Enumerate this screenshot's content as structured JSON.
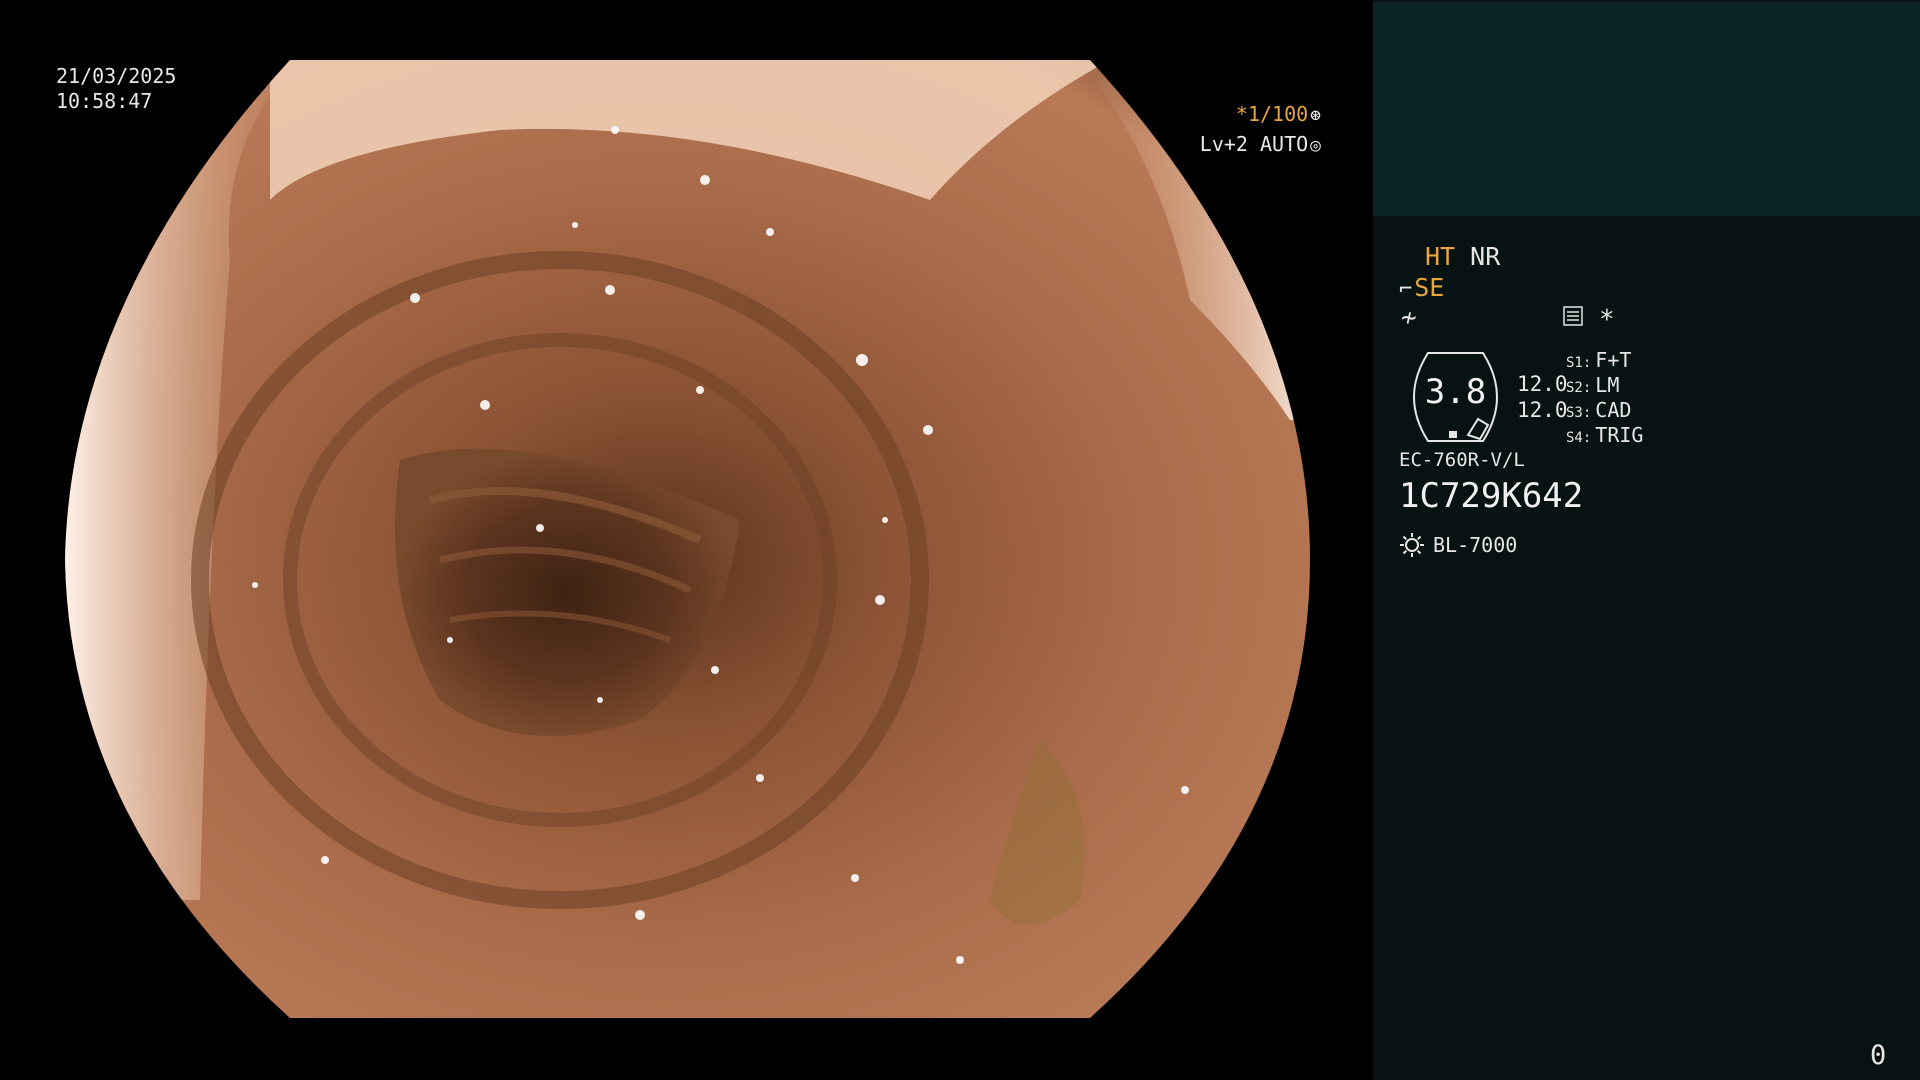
{
  "overlay": {
    "date": "21/03/2025",
    "time": "10:58:47",
    "shutter": "*1/100",
    "shutter_icon": "shutter-icon",
    "level": "Lv+2 AUTO",
    "auto_icon": "auto-iris-icon"
  },
  "panel": {
    "mode_ht": "HT",
    "mode_nr": "NR",
    "se_label": "SE",
    "star": "*",
    "gauge_value": "3.8",
    "gain_top": "12.0",
    "gain_bottom": "12.0",
    "switches": [
      {
        "key": "S1:",
        "value": "F+T"
      },
      {
        "key": "S2:",
        "value": "LM"
      },
      {
        "key": "S3:",
        "value": "CAD"
      },
      {
        "key": "S4:",
        "value": "TRIG"
      }
    ],
    "scope_model": "EC-760R-V/L",
    "serial": "1C729K642",
    "light_source": "BL-7000",
    "counter": "0"
  },
  "colors": {
    "accent": "#e8a540",
    "panel_bg": "#071213",
    "panel_top_bg": "#0c2425",
    "text": "#e6e6e6"
  }
}
